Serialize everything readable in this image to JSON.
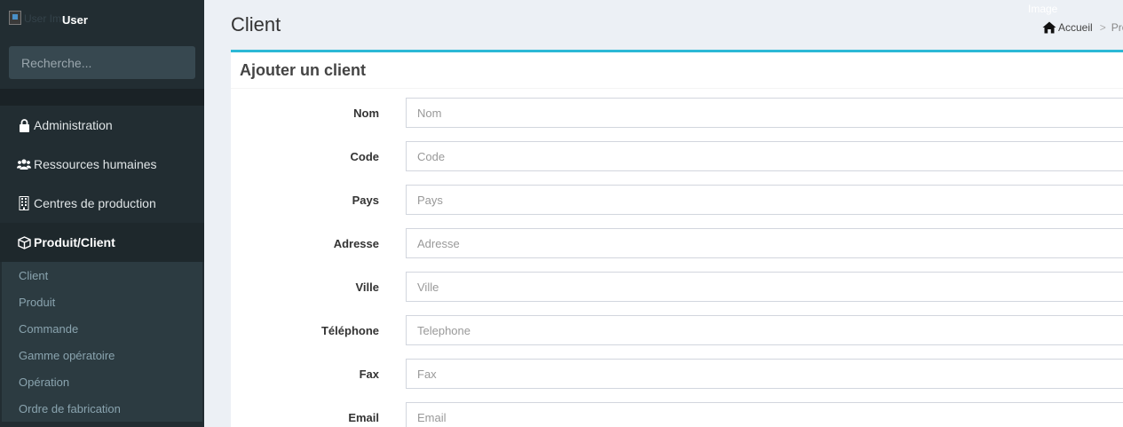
{
  "sidebar": {
    "user_img_alt": "User Image",
    "user_name": "User",
    "search_placeholder": "Recherche...",
    "items": [
      {
        "label": "Administration",
        "icon": "lock-icon"
      },
      {
        "label": "Ressources humaines",
        "icon": "users-icon"
      },
      {
        "label": "Centres de production",
        "icon": "building-icon"
      },
      {
        "label": "Produit/Client",
        "icon": "cube-icon",
        "active": true
      }
    ],
    "submenu": [
      "Client",
      "Produit",
      "Commande",
      "Gamme opératoire",
      "Opération",
      "Ordre de fabrication"
    ]
  },
  "header": {
    "title": "Client",
    "image_alt": "Image",
    "breadcrumb": {
      "home": "Accueil",
      "current": "Pro"
    }
  },
  "form": {
    "title": "Ajouter un client",
    "fields": [
      {
        "label": "Nom",
        "placeholder": "Nom"
      },
      {
        "label": "Code",
        "placeholder": "Code"
      },
      {
        "label": "Pays",
        "placeholder": "Pays"
      },
      {
        "label": "Adresse",
        "placeholder": "Adresse"
      },
      {
        "label": "Ville",
        "placeholder": "Ville"
      },
      {
        "label": "Téléphone",
        "placeholder": "Telephone"
      },
      {
        "label": "Fax",
        "placeholder": "Fax"
      },
      {
        "label": "Email",
        "placeholder": "Email"
      }
    ]
  },
  "colors": {
    "sidebar_bg": "#222d32",
    "accent": "#2cb8d6",
    "content_bg": "#ecf0f5"
  }
}
